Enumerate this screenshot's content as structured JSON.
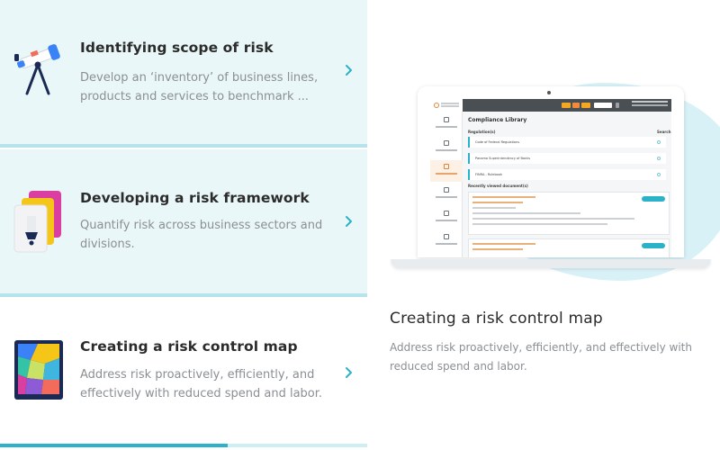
{
  "cards": [
    {
      "title": "Identifying scope of risk",
      "description": "Develop an ‘inventory’ of business lines, products and services to benchmark ...",
      "icon": "telescope-icon"
    },
    {
      "title": "Developing a risk framework",
      "description": "Quantify risk across business sectors and divisions.",
      "icon": "layered-documents-icon"
    },
    {
      "title": "Creating a risk control map",
      "description": "Address risk proactively, efficiently, and effectively with reduced spend and labor.",
      "icon": "colorful-map-icon"
    }
  ],
  "progress": {
    "fraction": 0.62
  },
  "detail": {
    "title": "Creating a risk control map",
    "description": "Address risk proactively, efficiently, and effectively with reduced spend and labor."
  },
  "screenshot": {
    "main_title": "Compliance Library",
    "regulations_heading": "Regulation(s)",
    "search_label": "Search",
    "regulations": [
      "Code of Federal Regulations",
      "Panama Superintendency of Banks",
      "FINRA - Rulebook"
    ],
    "recent_heading": "Recently viewed document(s)"
  },
  "colors": {
    "accent": "#2bb2c9",
    "card_bg": "#eaf7f8",
    "title": "#2b2b2b",
    "muted": "#8a8f94"
  }
}
